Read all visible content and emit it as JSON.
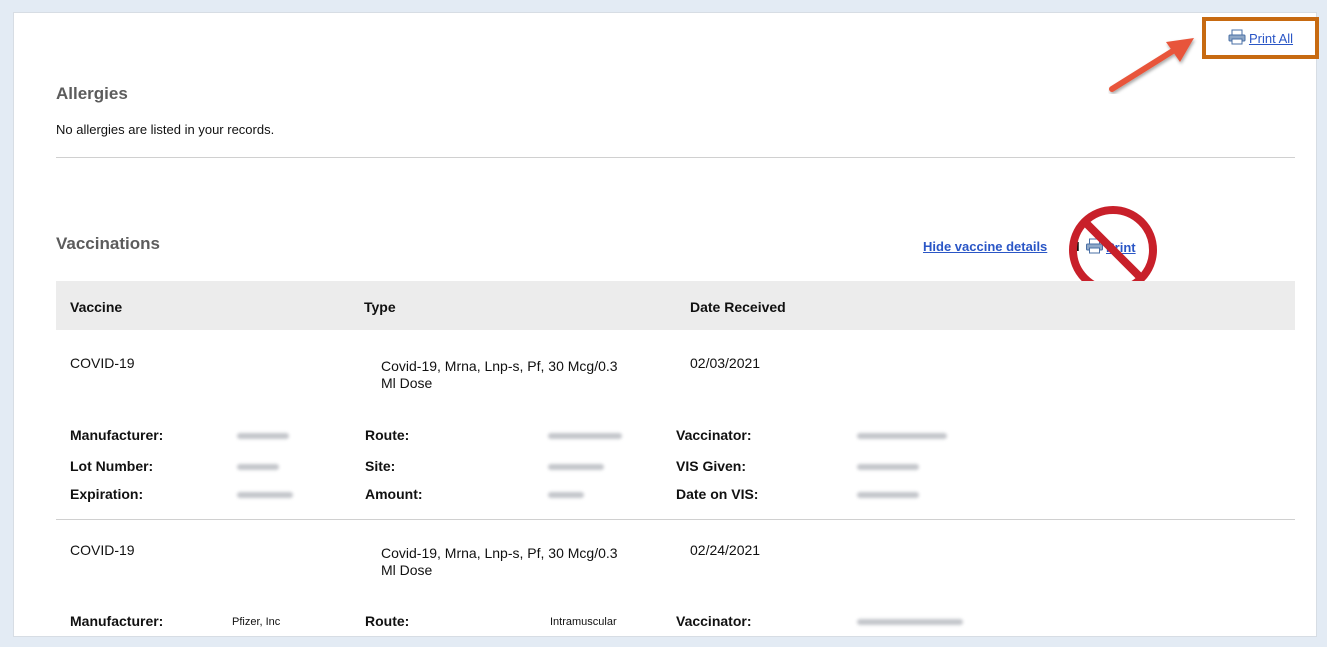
{
  "header": {
    "print_all_label": "Print All"
  },
  "allergies": {
    "title": "Allergies",
    "message": "No allergies are listed in your records."
  },
  "vaccinations": {
    "title": "Vaccinations",
    "hide_details_label": "Hide vaccine details",
    "separator": "I",
    "print_label": "Print",
    "columns": [
      "Vaccine",
      "Type",
      "Date Received"
    ],
    "detail_labels": {
      "manufacturer": "Manufacturer:",
      "route": "Route:",
      "vaccinator": "Vaccinator:",
      "lot_number": "Lot Number:",
      "site": "Site:",
      "vis_given": "VIS Given:",
      "expiration": "Expiration:",
      "amount": "Amount:",
      "date_on_vis": "Date on VIS:"
    },
    "records": [
      {
        "vaccine": "COVID-19",
        "type_line1": "Covid-19, Mrna, Lnp-s, Pf, 30 Mcg/0.3",
        "type_line2": "Ml Dose",
        "date_received": "02/03/2021"
      },
      {
        "vaccine": "COVID-19",
        "type_line1": "Covid-19, Mrna, Lnp-s, Pf, 30 Mcg/0.3",
        "type_line2": "Ml Dose",
        "date_received": "02/24/2021",
        "manufacturer": "Pfizer, Inc",
        "route": "Intramuscular"
      }
    ]
  },
  "colors": {
    "link": "#2a56c6",
    "highlight_box": "#c76a11",
    "arrow": "#e8553b",
    "no_sign": "#c8202a",
    "header_bg": "#ececec"
  },
  "icons": [
    "printer-icon",
    "arrow-icon",
    "no-symbol-icon"
  ]
}
